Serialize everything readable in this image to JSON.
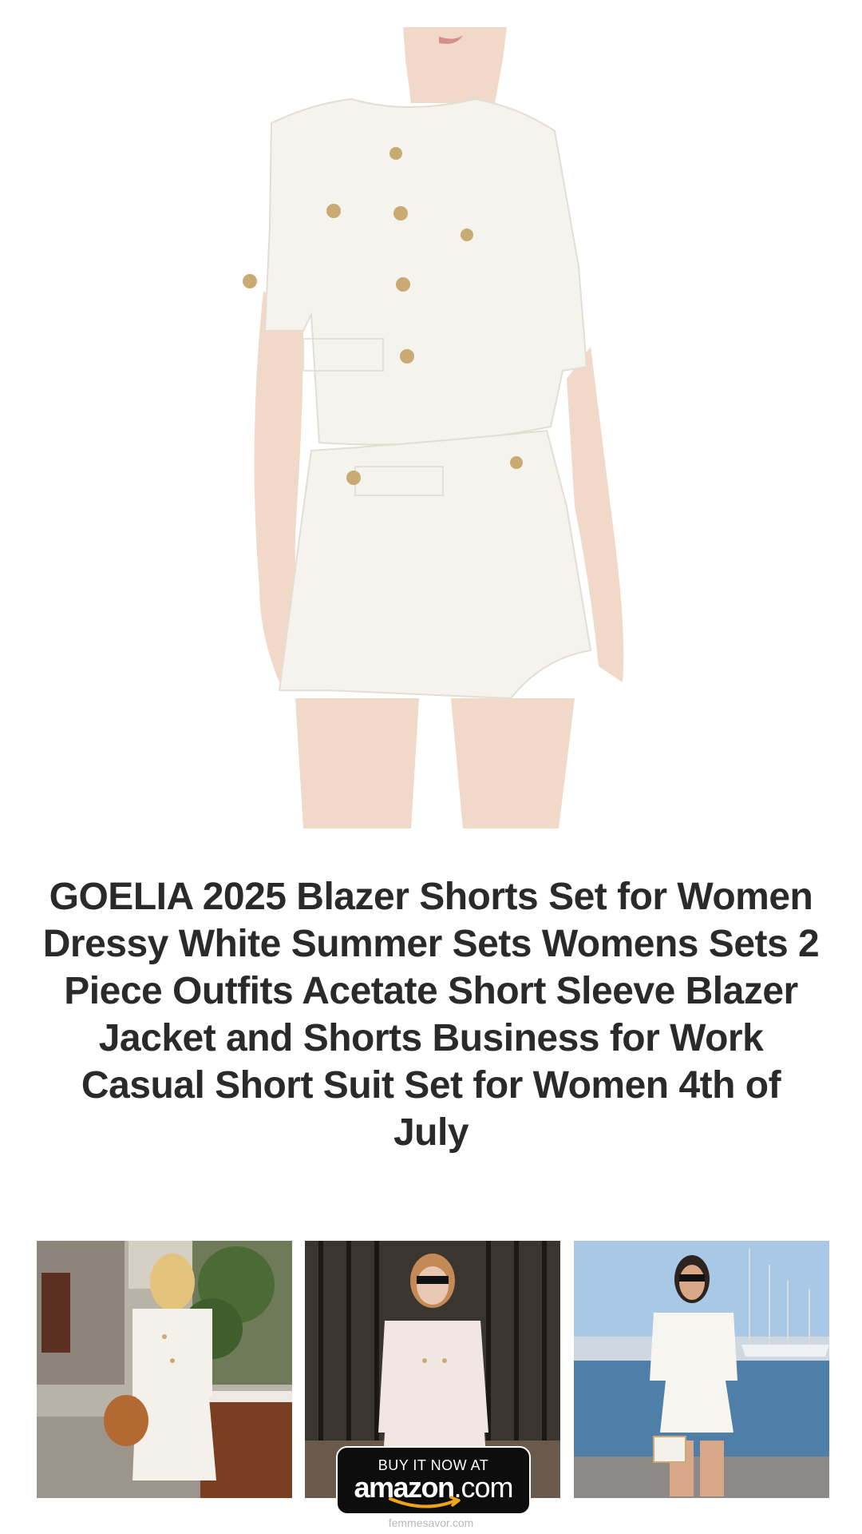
{
  "product": {
    "title": "GOELIA 2025 Blazer Shorts Set for Women Dressy White Summer Sets Womens Sets 2 Piece Outfits Acetate Short Sleeve Blazer Jacket and Shorts Business for Work Casual Short Suit Set for Women 4th of July",
    "main_image_icon": "product-photo-white-blazer-shorts-set"
  },
  "gallery": [
    {
      "icon": "lifestyle-photo-street-brown-bag"
    },
    {
      "icon": "lifestyle-photo-gate-sunglasses"
    },
    {
      "icon": "lifestyle-photo-harbor-sailboats"
    }
  ],
  "cta": {
    "top_line": "BUY IT NOW AT",
    "brand": "amazon",
    "brand_suffix": ".com",
    "button_color": "#0d0d0d",
    "smile_color": "#f0a41c"
  },
  "footer": {
    "site": "femmesavor.com"
  },
  "colors": {
    "background": "#ffffff",
    "title_text": "#2a2a2a",
    "garment": "#f4f2ec",
    "button_gold": "#c8aa72"
  }
}
